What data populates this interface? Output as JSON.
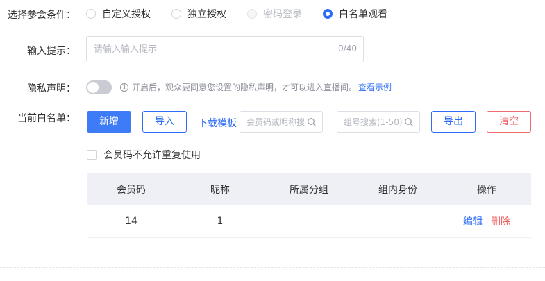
{
  "conditions": {
    "label": "选择参会条件：",
    "options": [
      {
        "label": "自定义授权",
        "state": "unchecked"
      },
      {
        "label": "独立授权",
        "state": "unchecked"
      },
      {
        "label": "密码登录",
        "state": "disabled"
      },
      {
        "label": "白名单观看",
        "state": "checked"
      }
    ]
  },
  "prompt": {
    "label": "输入提示：",
    "placeholder": "请输入输入提示",
    "value": "",
    "counter": "0/40"
  },
  "privacy": {
    "label": "隐私声明：",
    "enabled": false,
    "hint": "开启后，观众要同意您设置的隐私声明，才可以进入直播间。",
    "link": "查看示例"
  },
  "whitelist": {
    "label": "当前白名单：",
    "add_label": "新增",
    "import_label": "导入",
    "download_label": "下载模板",
    "member_search_placeholder": "会员码或昵称搜",
    "group_search_placeholder": "组号搜索(1-50)",
    "export_label": "导出",
    "clear_label": "清空",
    "no_repeat_label": "会员码不允许重复使用",
    "no_repeat_checked": false
  },
  "table": {
    "columns": [
      "会员码",
      "昵称",
      "所属分组",
      "组内身份",
      "操作"
    ],
    "rows": [
      {
        "code": "14",
        "nickname": "1",
        "group": "",
        "role": ""
      }
    ],
    "edit_label": "编辑",
    "delete_label": "删除"
  },
  "colors": {
    "accent": "#2f6df6",
    "danger": "#ef5b5b"
  }
}
